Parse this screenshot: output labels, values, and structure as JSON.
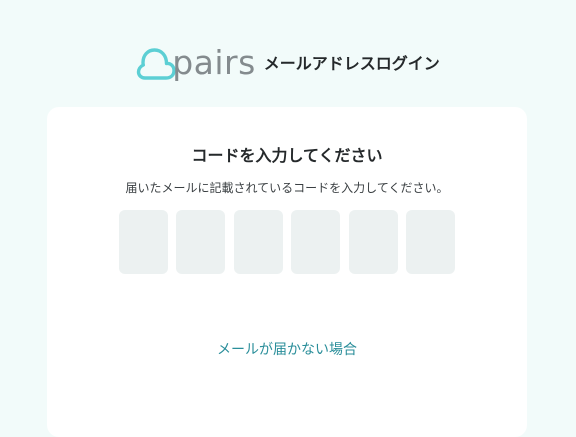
{
  "header": {
    "logo_text": "pairs",
    "title": "メールアドレスログイン"
  },
  "card": {
    "title": "コードを入力してください",
    "description": "届いたメールに記載されているコードを入力してください。",
    "code_inputs": [
      {
        "value": ""
      },
      {
        "value": ""
      },
      {
        "value": ""
      },
      {
        "value": ""
      },
      {
        "value": ""
      },
      {
        "value": ""
      }
    ],
    "help_link": "メールが届かない場合"
  },
  "colors": {
    "brand_cyan": "#5ccfd4",
    "logo_gray": "#848b8e",
    "link": "#2a8e9a",
    "background": "#f2fbfa",
    "input_bg": "#ecf1f1"
  }
}
